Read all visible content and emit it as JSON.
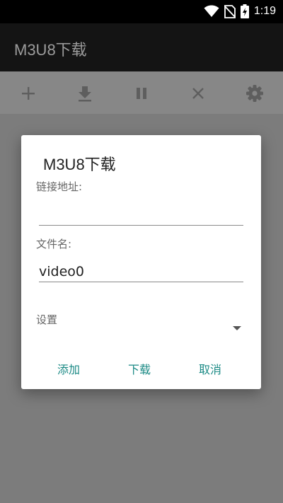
{
  "status_bar": {
    "time": "1:19",
    "icons": [
      "wifi-icon",
      "no-sim-icon",
      "battery-charging-icon"
    ]
  },
  "app_bar": {
    "title": "M3U8下载"
  },
  "toolbar": {
    "actions": [
      "add-icon",
      "download-icon",
      "pause-icon",
      "close-icon",
      "settings-icon"
    ]
  },
  "dialog": {
    "title": "M3U8下载",
    "url_label": "链接地址:",
    "url_value": "",
    "filename_label": "文件名:",
    "filename_value": "video0",
    "settings_label": "设置",
    "buttons": {
      "add": "添加",
      "download": "下载",
      "cancel": "取消"
    }
  },
  "colors": {
    "accent": "#1b8a85",
    "app_bar": "#141414",
    "scrim": "#7c7c7c"
  }
}
